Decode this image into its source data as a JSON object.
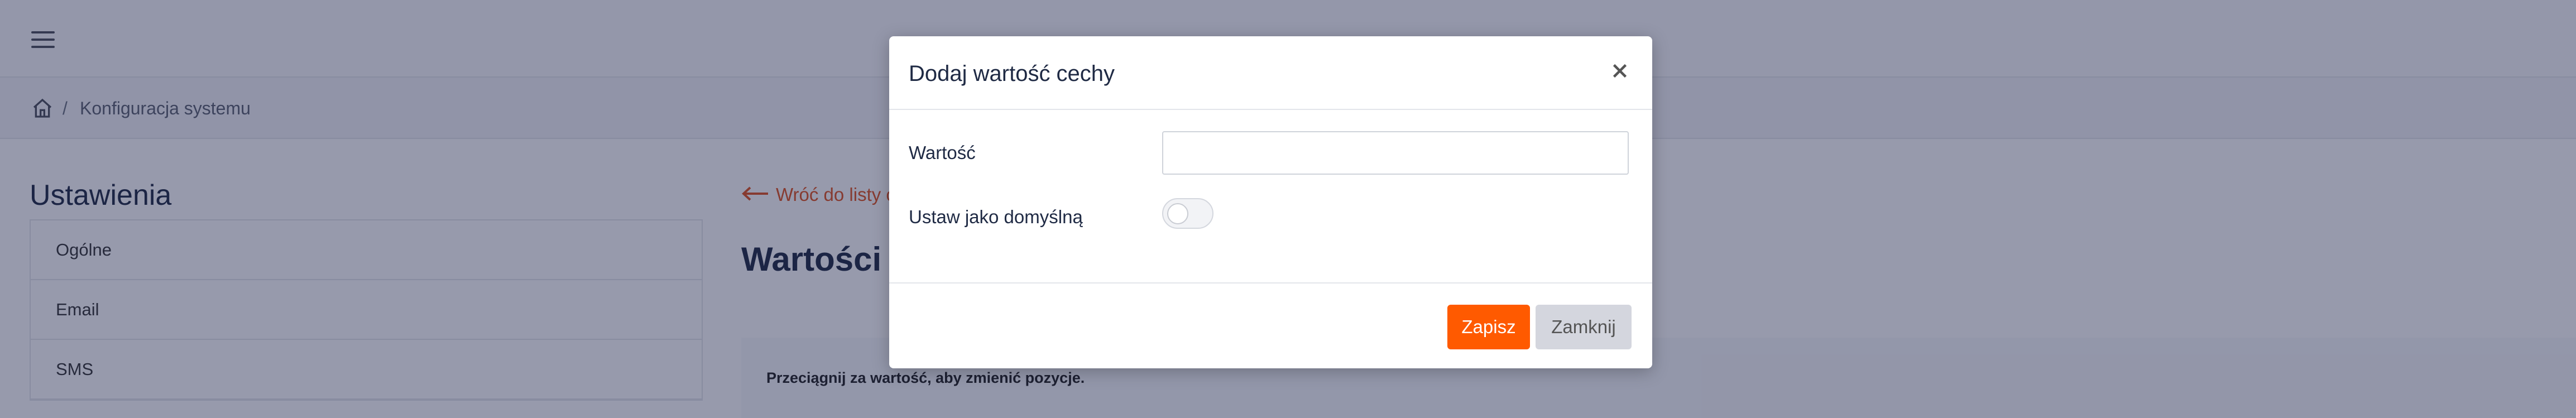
{
  "breadcrumb": {
    "current": "Konfiguracja systemu",
    "separator": "/"
  },
  "settings": {
    "title": "Ustawienia",
    "items": [
      {
        "label": "Ogólne"
      },
      {
        "label": "Email"
      },
      {
        "label": "SMS"
      }
    ]
  },
  "main": {
    "back_link": "Wróć do listy c",
    "heading": "Wartości c",
    "hint": "Przeciągnij za wartość, aby zmienić pozycje."
  },
  "modal": {
    "title": "Dodaj wartość cechy",
    "value_label": "Wartość",
    "value_input": "",
    "default_label": "Ustaw jako domyślną",
    "default_on": false,
    "save_label": "Zapisz",
    "close_label": "Zamknij"
  },
  "colors": {
    "accent": "#ff5a00",
    "link": "#e0521f",
    "overlay": "rgba(24,30,70,0.45)"
  },
  "icons": [
    "hamburger-icon",
    "home-icon",
    "close-icon",
    "arrow-left-icon"
  ]
}
